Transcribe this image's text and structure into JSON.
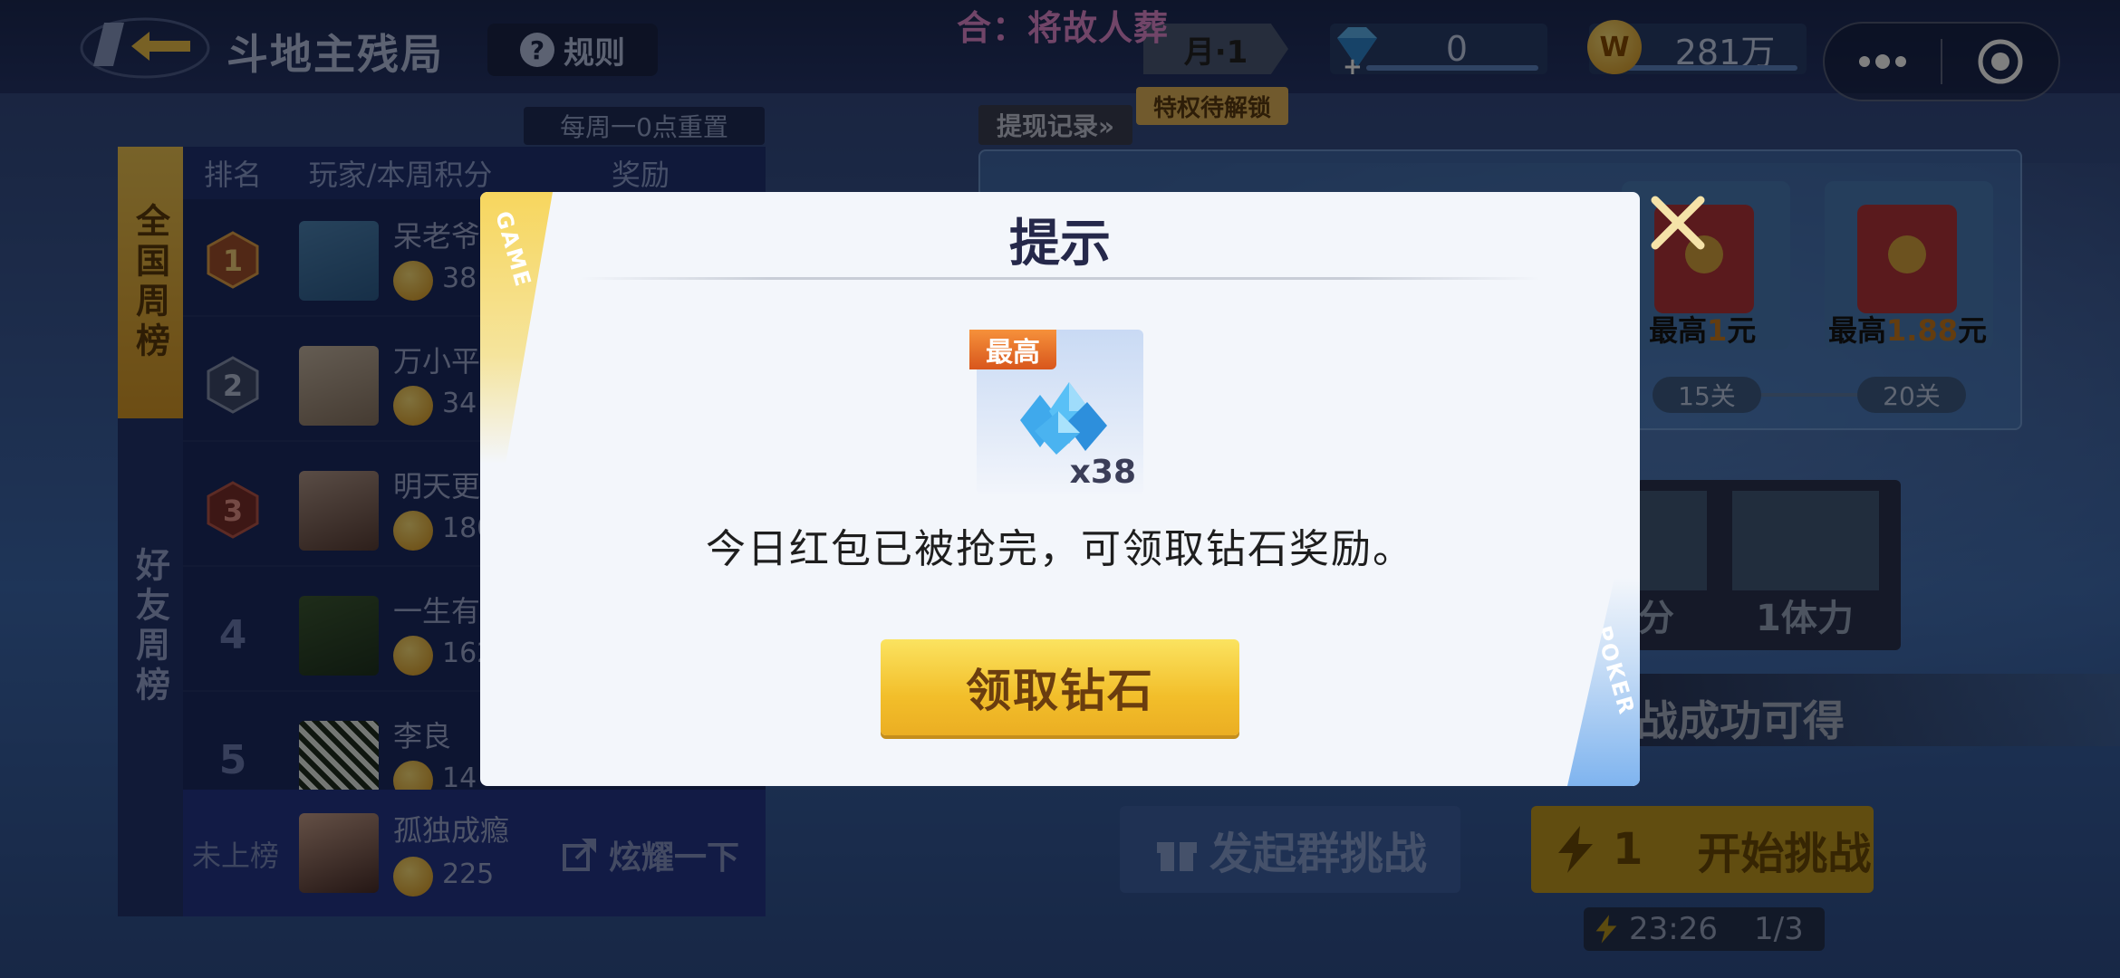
{
  "header": {
    "game_title": "斗地主残局",
    "rules_label": "规则",
    "watermark": "合：将故人葬",
    "month_badge": "月·1",
    "privilege_label": "特权待解锁",
    "diamond_count": "0",
    "coin_count": "281万"
  },
  "leaderboard": {
    "reset_note": "每周一0点重置",
    "tabs": [
      "全国周榜",
      "好友周榜"
    ],
    "columns": [
      "排名",
      "玩家/本周积分",
      "奖励"
    ],
    "rows": [
      {
        "rank": "1",
        "name": "呆老爷",
        "score": "38"
      },
      {
        "rank": "2",
        "name": "万小平",
        "score": "34"
      },
      {
        "rank": "3",
        "name": "明天更",
        "score": "180"
      },
      {
        "rank": "4",
        "name": "一生有",
        "score": "162"
      },
      {
        "rank": "5",
        "name": "李良",
        "score": "14"
      }
    ],
    "me": {
      "label": "未上榜",
      "name": "孤独成瘾",
      "score": "225",
      "share": "炫耀一下"
    }
  },
  "rewards": {
    "withdraw_label": "提现记录»",
    "cards": [
      {
        "text_pre": "最高",
        "amount": "1",
        "text_post": "元",
        "level": "15关"
      },
      {
        "text_pre": "最高",
        "amount": "1.88",
        "text_post": "元",
        "level": "20关"
      }
    ],
    "prizes": [
      "分",
      "1体力"
    ],
    "strip_text": "战成功可得"
  },
  "actions": {
    "group_challenge": "发起群挑战",
    "start_challenge": "开始挑战",
    "start_cost": "1",
    "timer": "23:26",
    "attempts": "1/3"
  },
  "dialog": {
    "title": "提示",
    "corner_top": "GAME",
    "corner_bottom": "POKER",
    "badge": "最高",
    "reward_count": "x38",
    "message": "今日红包已被抢完，可领取钻石奖励。",
    "claim_label": "领取钻石"
  },
  "colors": {
    "accent_gold": "#f2be2a",
    "dialog_bg": "#f3f6fb",
    "badge_orange": "#e86a25",
    "watermark_pink": "#e38ad0"
  },
  "icons": [
    "back-arrow-icon",
    "question-icon",
    "diamond-icon",
    "coin-icon",
    "more-icon",
    "target-icon",
    "close-icon",
    "share-icon",
    "gift-icon",
    "lightning-icon"
  ]
}
